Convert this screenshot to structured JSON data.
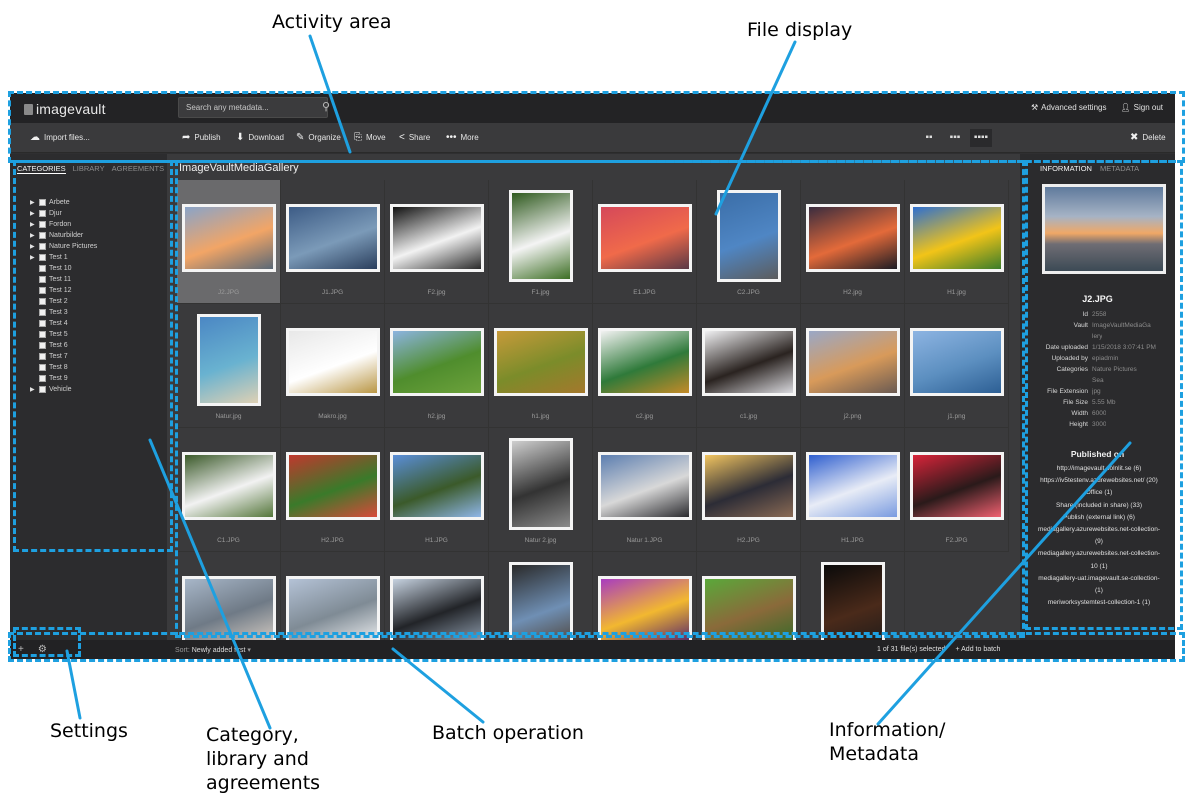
{
  "callouts": {
    "activity_area": "Activity area",
    "file_display": "File display",
    "settings": "Settings",
    "category": [
      "Category,",
      "library and",
      "agreements"
    ],
    "batch": "Batch operation",
    "information": [
      "Information/",
      "Metadata"
    ]
  },
  "topbar": {
    "logo": "imagevault",
    "search_placeholder": "Search any metadata...",
    "advanced": "Advanced settings",
    "signout": "Sign out"
  },
  "toolbar": {
    "import": "Import files...",
    "publish": "Publish",
    "download": "Download",
    "organize": "Organize",
    "move": "Move",
    "share": "Share",
    "more": "More",
    "delete": "Delete"
  },
  "sidebar": {
    "tabs": [
      "CATEGORIES",
      "LIBRARY",
      "AGREEMENTS"
    ],
    "items": [
      {
        "label": "Arbete",
        "expand": true
      },
      {
        "label": "Djur",
        "expand": true
      },
      {
        "label": "Fordon",
        "expand": true
      },
      {
        "label": "Naturbilder",
        "expand": true
      },
      {
        "label": "Nature Pictures",
        "expand": true
      },
      {
        "label": "Test 1",
        "expand": true
      },
      {
        "label": "Test 10",
        "expand": false
      },
      {
        "label": "Test 11",
        "expand": false
      },
      {
        "label": "Test 12",
        "expand": false
      },
      {
        "label": "Test 2",
        "expand": false
      },
      {
        "label": "Test 3",
        "expand": false
      },
      {
        "label": "Test 4",
        "expand": false
      },
      {
        "label": "Test 5",
        "expand": false
      },
      {
        "label": "Test 6",
        "expand": false
      },
      {
        "label": "Test 7",
        "expand": false
      },
      {
        "label": "Test 8",
        "expand": false
      },
      {
        "label": "Test 9",
        "expand": false
      },
      {
        "label": "Vehicle",
        "expand": true
      }
    ]
  },
  "gallery": {
    "title": "ImageVaultMediaGallery",
    "files": [
      {
        "name": "J2.JPG",
        "selected": true,
        "colors": [
          "#8aa4c8",
          "#f2a566",
          "#5a6876"
        ],
        "shape": "wide"
      },
      {
        "name": "J1.JPG",
        "colors": [
          "#3d5c86",
          "#7b9ab8",
          "#2a3e5c"
        ],
        "shape": "wide"
      },
      {
        "name": "F2.jpg",
        "colors": [
          "#111111",
          "#f2f2f2",
          "#2a2a2a"
        ],
        "shape": "wide"
      },
      {
        "name": "F1.jpg",
        "colors": [
          "#2f5a1e",
          "#f4f4f4",
          "#3d6f24"
        ],
        "shape": "tall"
      },
      {
        "name": "E1.JPG",
        "colors": [
          "#d5485a",
          "#f06a4a",
          "#5a3845"
        ],
        "shape": "wide"
      },
      {
        "name": "C2.JPG",
        "colors": [
          "#3b6ea8",
          "#4f86c4",
          "#5c5c5c"
        ],
        "shape": "tall"
      },
      {
        "name": "H2.jpg",
        "colors": [
          "#3a2c3e",
          "#e36a3a",
          "#1c1c24"
        ],
        "shape": "wide"
      },
      {
        "name": "H1.jpg",
        "colors": [
          "#2e6fd0",
          "#f2c418",
          "#3b7d2a"
        ],
        "shape": "wide"
      },
      {
        "name": "Natur.jpg",
        "colors": [
          "#4b87c4",
          "#69b2d0",
          "#ded0b4"
        ],
        "shape": "tall"
      },
      {
        "name": "Makro.jpg",
        "colors": [
          "#e8e8e8",
          "#ffffff",
          "#b99644"
        ],
        "shape": "wide"
      },
      {
        "name": "h2.jpg",
        "colors": [
          "#8cb4e0",
          "#4f8d2d",
          "#6da23c"
        ],
        "shape": "wide"
      },
      {
        "name": "h1.jpg",
        "colors": [
          "#c79a3a",
          "#7b8c2a",
          "#a4782c"
        ],
        "shape": "wide"
      },
      {
        "name": "c2.jpg",
        "colors": [
          "#f2f2f2",
          "#2f7a3a",
          "#c48a28"
        ],
        "shape": "wide"
      },
      {
        "name": "c1.jpg",
        "colors": [
          "#f0f0f2",
          "#2a2320",
          "#d9d9de"
        ],
        "shape": "wide"
      },
      {
        "name": "j2.png",
        "colors": [
          "#9aa8c6",
          "#d89a5a",
          "#6a5a52"
        ],
        "shape": "wide"
      },
      {
        "name": "j1.png",
        "colors": [
          "#8db4e2",
          "#5c8fc0",
          "#2d5f94"
        ],
        "shape": "wide"
      },
      {
        "name": "C1.JPG",
        "colors": [
          "#3b5a2a",
          "#f2f2f2",
          "#54763a"
        ],
        "shape": "wide"
      },
      {
        "name": "H2.JPG",
        "colors": [
          "#c0382e",
          "#3a7a2a",
          "#d84a3a"
        ],
        "shape": "wide"
      },
      {
        "name": "H1.JPG",
        "colors": [
          "#5a8ed8",
          "#3b5a2a",
          "#8fb6e8"
        ],
        "shape": "wide"
      },
      {
        "name": "Natur 2.jpg",
        "colors": [
          "#cfcfcf",
          "#333333",
          "#8a8a8a"
        ],
        "shape": "tall"
      },
      {
        "name": "Natur 1.JPG",
        "colors": [
          "#5c7eb0",
          "#d8d8d8",
          "#2a2a2e"
        ],
        "shape": "wide"
      },
      {
        "name": "H2.JPG",
        "colors": [
          "#f1c460",
          "#2c2c36",
          "#8a6a54"
        ],
        "shape": "wide"
      },
      {
        "name": "H1.JPG",
        "colors": [
          "#2f5fcf",
          "#e8ecf6",
          "#7a9be0"
        ],
        "shape": "wide"
      },
      {
        "name": "F2.JPG",
        "colors": [
          "#d8243a",
          "#2a1a1a",
          "#f06070"
        ],
        "shape": "wide"
      },
      {
        "name": "",
        "colors": [
          "#a7b6c8",
          "#6f7a86",
          "#d0c8c0"
        ],
        "shape": "wide"
      },
      {
        "name": "",
        "colors": [
          "#b4c2d6",
          "#7f8b95",
          "#e8eaec"
        ],
        "shape": "wide"
      },
      {
        "name": "",
        "colors": [
          "#c6d2e0",
          "#222428",
          "#8a98a8"
        ],
        "shape": "wide"
      },
      {
        "name": "",
        "colors": [
          "#2a2a2a",
          "#6f8fb4",
          "#4a3a2a"
        ],
        "shape": "tall"
      },
      {
        "name": "",
        "colors": [
          "#a83cc0",
          "#f2b830",
          "#5a2a6a"
        ],
        "shape": "wide"
      },
      {
        "name": "",
        "colors": [
          "#5aa83a",
          "#8a6a3a",
          "#3a6a2a"
        ],
        "shape": "wide"
      },
      {
        "name": "",
        "colors": [
          "#0a0a0a",
          "#4a2a1a",
          "#1a1a1a"
        ],
        "shape": "tall"
      }
    ]
  },
  "info": {
    "tabs": [
      "INFORMATION",
      "METADATA"
    ],
    "title": "J2.JPG",
    "rows": [
      {
        "k": "Id",
        "v": "2558"
      },
      {
        "k": "Vault",
        "v": "ImageVaultMediaGa"
      },
      {
        "k": "",
        "v": "lery"
      },
      {
        "k": "Date uploaded",
        "v": "1/15/2018 3:07:41 PM"
      },
      {
        "k": "Uploaded by",
        "v": "epiadmin"
      },
      {
        "k": "Categories",
        "v": "Nature Pictures"
      },
      {
        "k": "",
        "v": "Sea"
      },
      {
        "k": "File Extension",
        "v": "jpg"
      },
      {
        "k": "File Size",
        "v": "5.55 Mb"
      },
      {
        "k": "Width",
        "v": "6000"
      },
      {
        "k": "Height",
        "v": "3000"
      }
    ],
    "published_title": "Published on",
    "published": [
      "http://imagevault.solnlit.se (6)",
      "https://iv5testenv.azurewebsites.net/ (20)",
      "Office (1)",
      "Share (included in share) (33)",
      "Publish (external link) (6)",
      "mediagallery.azurewebsites.net-collection-",
      "(9)",
      "mediagallery.azurewebsites.net-collection-",
      "10 (1)",
      "mediagallery-uat.imagevault.se-collection-",
      "(1)",
      "meriworksystemtest-collection-1 (1)"
    ]
  },
  "bottombar": {
    "sort_label": "Sort:",
    "sort_value": "Newly added first",
    "selection": "1 of 31 file(s) selected",
    "add_batch": "Add to batch"
  }
}
